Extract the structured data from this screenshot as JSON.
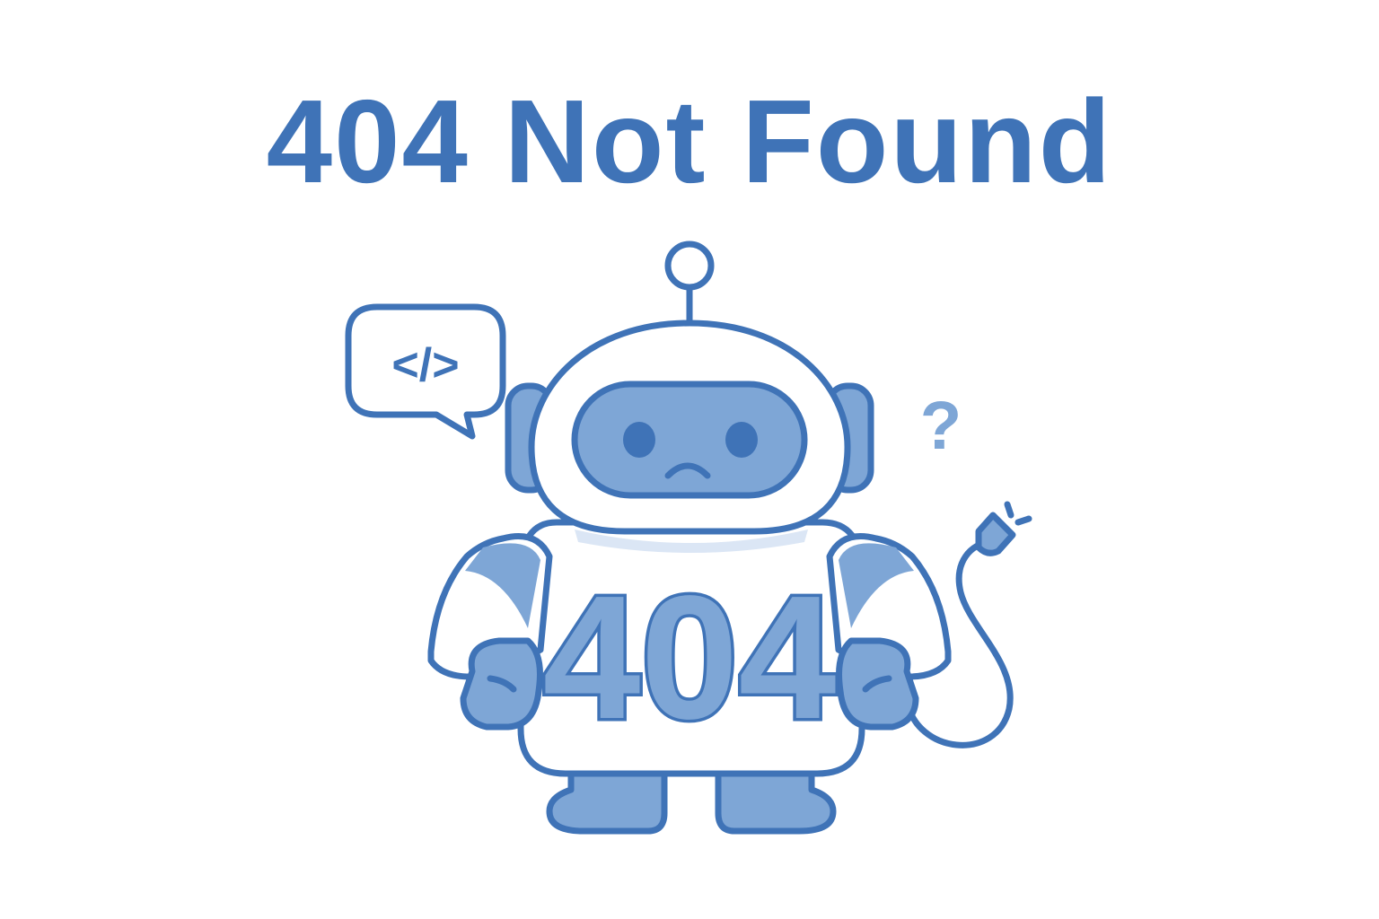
{
  "title": "404 Not Found",
  "robot": {
    "chest_label": "404",
    "speech_bubble_text": "</>",
    "question_mark": "?"
  },
  "colors": {
    "primary": "#3f73b7",
    "fill": "#7ea6d6",
    "background": "#ffffff"
  },
  "icons": [
    "robot-illustration",
    "code-speech-bubble-icon",
    "question-mark-icon",
    "unplugged-cable-icon"
  ]
}
